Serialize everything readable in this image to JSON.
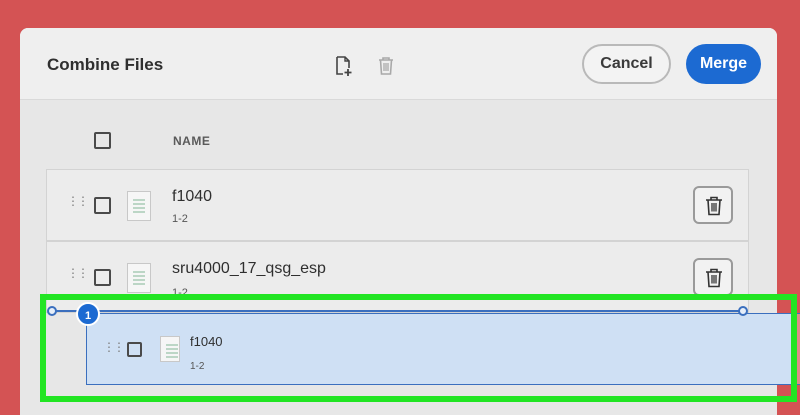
{
  "dialog": {
    "title": "Combine Files",
    "toolbar": {
      "add_icon": "add-file-icon",
      "delete_icon": "trash-icon"
    },
    "cancel_label": "Cancel",
    "merge_label": "Merge"
  },
  "list": {
    "column_name": "NAME",
    "files": [
      {
        "name": "f1040",
        "pages": "1-2"
      },
      {
        "name": "sru4000_17_qsg_esp",
        "pages": "1-2"
      }
    ]
  },
  "drag": {
    "badge": "1",
    "file": {
      "name": "f1040",
      "pages": "1-2"
    }
  },
  "colors": {
    "background": "#d45354",
    "accent": "#1c6ad2",
    "highlight": "#22e523",
    "drag_card": "#cfe0f4"
  }
}
